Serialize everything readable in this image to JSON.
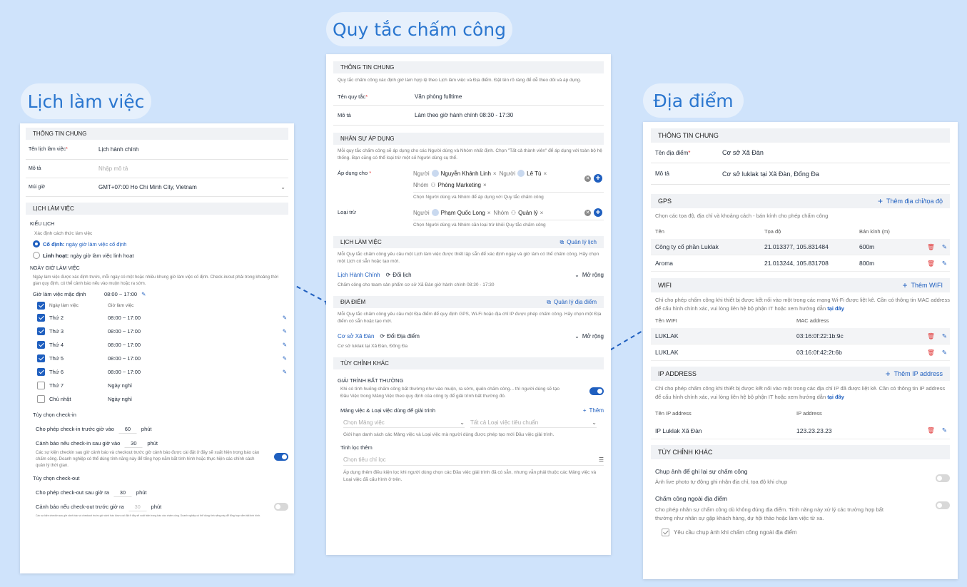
{
  "titles": {
    "left": "Lịch làm việc",
    "middle": "Quy tắc chấm công",
    "right": "Địa điểm"
  },
  "left": {
    "sec_general": "THÔNG TIN CHUNG",
    "name_label": "Tên lịch làm việc",
    "required_mark": "*",
    "name_value": "Lịch hành chính",
    "desc_label": "Mô tả",
    "desc_placeholder": "Nhập mô tả",
    "tz_label": "Múi giờ",
    "tz_value": "GMT+07:00 Ho Chi Minh City, Vietnam",
    "sec_schedule": "LỊCH LÀM VIỆC",
    "type_heading": "KIỂU LỊCH",
    "type_desc": "Xác định cách thức làm việc",
    "fixed_bold": "Cố định:",
    "fixed_rest": " ngày giờ làm việc cố định",
    "flex_bold": "Linh hoạt:",
    "flex_rest": " ngày giờ làm việc linh hoạt",
    "days_heading": "NGÀY GIỜ LÀM VIỆC",
    "days_desc": "Ngày làm việc được xác định trước, mỗi ngày có một hoặc nhiều khung giờ làm việc cố định. Check-in/out phải trong khoảng thời gian quy định, có thể cảnh báo nếu vào muộn hoặc ra sớm.",
    "default_label": "Giờ làm việc mặc định",
    "default_value": "08:00 ~ 17:00",
    "col_day": "Ngày làm việc",
    "col_hours": "Giờ làm việc",
    "days": [
      {
        "day": "Thứ 2",
        "hours": "08:00 ~ 17:00",
        "checked": true
      },
      {
        "day": "Thứ 3",
        "hours": "08:00 ~ 17:00",
        "checked": true
      },
      {
        "day": "Thứ 4",
        "hours": "08:00 ~ 17:00",
        "checked": true
      },
      {
        "day": "Thứ 5",
        "hours": "08:00 ~ 17:00",
        "checked": true
      },
      {
        "day": "Thứ 6",
        "hours": "08:00 ~ 17:00",
        "checked": true
      },
      {
        "day": "Thứ 7",
        "hours": "Ngày nghỉ",
        "checked": false
      },
      {
        "day": "Chủ nhật",
        "hours": "Ngày nghỉ",
        "checked": false
      }
    ],
    "checkin_heading": "Tùy chọn check-in",
    "checkin_before": "Cho phép check-in trước giờ vào",
    "checkin_before_val": "60",
    "unit": "phút",
    "checkin_warn": "Cảnh báo nếu check-in sau giờ vào",
    "checkin_warn_val": "30",
    "checkin_warn_desc": "Các sự kiện checkin sau giờ cảnh báo và checkout trước giờ cảnh báo được cài đặt ở đây sẽ xuất hiện trong báo cáo chấm công. Doanh nghiệp có thể dùng tính năng này để tổng hợp nắm bắt tình hình hoặc thực hiện các chính sách quản lý thời gian.",
    "checkout_heading": "Tùy chọn check-out",
    "checkout_after": "Cho phép check-out sau giờ ra",
    "checkout_after_val": "30",
    "checkout_warn": "Cảnh báo nếu check-out trước giờ ra",
    "checkout_warn_val": "30",
    "checkout_warn_desc": "Các sự kiện checkin sau giờ cảnh báo và checkout trước giờ cảnh báo được cài đặt ở đây sẽ xuất hiện trong báo cáo chấm công. Doanh nghiệp có thể dùng tính năng này để tổng hợp nắm bắt tình hình."
  },
  "middle": {
    "sec_general": "THÔNG TIN CHUNG",
    "general_desc": "Quy tắc chấm công xác định giờ làm hợp lệ theo Lịch làm việc và Địa điểm. Đặt tên rõ ràng để dễ theo dõi và áp dụng.",
    "rule_name_label": "Tên quy tắc",
    "required_mark": "*",
    "rule_name_value": "Văn phòng fulltime",
    "desc_label": "Mô tả",
    "desc_value": "Làm theo giờ hành chính 08:30 - 17:30",
    "sec_staff": "NHÂN SỰ ÁP DỤNG",
    "staff_desc": "Mỗi quy tắc chấm công sẽ áp dụng cho các Người dùng và Nhóm nhất định. Chọn \"Tất cả thành viên\" để áp dụng với toàn bộ hệ thống. Bạn cũng có thể loại trừ một số Người dùng cụ thể.",
    "apply_label": "Áp dụng cho",
    "tag_user_prefix": "Người",
    "tag_group_prefix": "Nhóm",
    "apply_user1": "Nguyễn Khánh Linh",
    "apply_user2": "Lê Tú",
    "apply_group": "Phòng Marketing",
    "apply_hint": "Chọn Người dùng và Nhóm để áp dụng với Quy tắc chấm công",
    "exclude_label": "Loại trừ",
    "exclude_user": "Phạm Quốc Long",
    "exclude_group": "Quản lý",
    "exclude_hint": "Chọn Người dùng và Nhóm cần loại trừ khỏi Quy tắc chấm công",
    "sec_schedule": "LỊCH LÀM VIỆC",
    "manage_schedule": "Quản lý lịch",
    "schedule_desc": "Mỗi Quy tắc chấm công yêu cầu một Lịch làm việc được thiết lập sẵn để xác định ngày và giờ làm có thể chấm công. Hãy chọn một Lịch có sẵn hoặc tạo mới.",
    "schedule_name": "Lịch Hành Chính",
    "change_schedule": "Đổi lịch",
    "expand": "Mở rộng",
    "schedule_sub": "Chấm công cho team sản phẩm cơ sở Xã Đàn giờ hành chính 08:30 - 17:30",
    "sec_location": "ĐỊA ĐIỂM",
    "manage_location": "Quản lý địa điểm",
    "location_desc": "Mỗi Quy tắc chấm công yêu cầu một Địa điểm để quy định GPS, Wi-Fi hoặc địa chỉ IP được phép chấm công. Hãy chọn một Địa điểm có sẵn hoặc tạo mới.",
    "location_name": "Cơ sở Xã Đàn",
    "change_location": "Đổi Địa điểm",
    "location_sub": "Cơ sở luklak tại Xã Đàn, Đống Đa",
    "sec_custom": "TÙY CHỈNH KHÁC",
    "explain_heading": "GIẢI TRÌNH BẤT THƯỜNG",
    "explain_desc": "Khi có tình huống chấm công bất thường như vào muộn, ra sớm, quên chấm công... thì người dùng sẽ tạo Đầu Việc trong Mảng Việc theo quy định của công ty để giải trình bất thường đó.",
    "board_heading": "Mảng việc & Loại việc dùng để giải trình",
    "add": "Thêm",
    "board_placeholder": "Chọn Mảng việc",
    "type_placeholder": "Tất cả Loại việc tiêu chuẩn",
    "board_hint": "Giới hạn danh sách các Mảng việc và Loại việc mà người dùng được phép tạo mới Đầu việc giải trình.",
    "filter_heading": "Tinh lọc thêm",
    "filter_placeholder": "Chọn tiêu chí lọc",
    "filter_hint": "Áp dụng thêm điều kiện lọc khi người dùng chọn các Đầu việc giải trình đã có sẵn, nhưng vẫn phải thuộc các Mảng việc và Loại việc đã cấu hình ở trên."
  },
  "right": {
    "sec_general": "THÔNG TIN CHUNG",
    "name_label": "Tên địa điểm",
    "required_mark": "*",
    "name_value": "Cơ sở Xã Đàn",
    "desc_label": "Mô tả",
    "desc_value": "Cơ sở luklak tại Xã Đàn, Đống Đa",
    "sec_gps": "GPS",
    "add_gps": "Thêm địa chỉ/tọa độ",
    "gps_desc": "Chọn các tọa độ, địa chỉ và khoảng cách - bán kính cho phép chấm công",
    "gps_cols": [
      "Tên",
      "Tọa độ",
      "Bán kính (m)"
    ],
    "gps_rows": [
      {
        "name": "Công ty cổ phần Luklak",
        "coord": "21.013377, 105.831484",
        "radius": "600m"
      },
      {
        "name": "Aroma",
        "coord": "21.013244, 105.831708",
        "radius": "800m"
      }
    ],
    "sec_wifi": "WIFI",
    "add_wifi": "Thêm WIFI",
    "wifi_desc": "Chỉ cho phép chấm công khi thiết bị được kết nối vào một trong các mạng Wi-Fi được liệt kê. Cần có thông tin MAC address để cấu hình chính xác, vui lòng liên hệ bộ phận IT hoặc xem hướng dẫn ",
    "here": "tại đây",
    "wifi_cols": [
      "Tên WIFI",
      "MAC address"
    ],
    "wifi_rows": [
      {
        "name": "LUKLAK",
        "mac": "03:16:0f:22:1b:9c"
      },
      {
        "name": "LUKLAK",
        "mac": "03:16:0f:42:2t:6b"
      }
    ],
    "sec_ip": "IP ADDRESS",
    "add_ip": "Thêm IP address",
    "ip_desc": "Chỉ cho phép chấm công khi thiết bị được kết nối vào một trong các địa chỉ IP đã được liệt kê. Cần có thông tin IP address để cấu hình chính xác, vui lòng liên hệ bộ phận IT hoặc xem hướng dẫn ",
    "ip_cols": [
      "Tên IP address",
      "IP address"
    ],
    "ip_rows": [
      {
        "name": "IP Luklak Xã Đàn",
        "ip": "123.23.23.23"
      }
    ],
    "sec_custom": "TÙY CHỈNH KHÁC",
    "photo_heading": "Chụp ảnh để ghi lại sự chấm công",
    "photo_desc": "Ảnh live photo tự động ghi nhận địa chỉ, tọa độ khi chụp",
    "outside_heading": "Chấm công ngoài địa điểm",
    "outside_desc": "Cho phép nhân sự chấm công dù không đúng địa điểm. Tính năng này xử lý các trường hợp bất thường như nhân sự gặp khách hàng, dự hội thảo hoặc làm việc từ xa.",
    "outside_photo": "Yêu cầu chụp ảnh khi chấm công ngoài địa điểm"
  },
  "colors": {
    "accent": "#1f5fbf",
    "background": "#cfe3fb",
    "title_text": "#2a76cf",
    "danger": "#e03131"
  },
  "icons": [
    "edit-icon",
    "chevron-down-icon",
    "trash-icon",
    "plus-icon",
    "external-link-icon",
    "refresh-icon",
    "filter-icon",
    "close-icon",
    "user-avatar-icon",
    "group-icon"
  ]
}
